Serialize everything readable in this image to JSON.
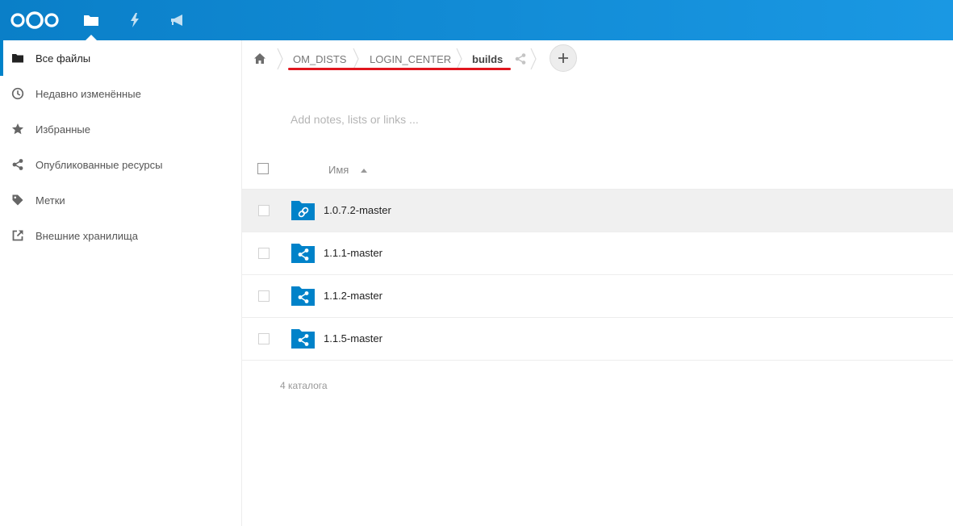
{
  "header": {
    "apps": [
      {
        "icon": "folder-icon",
        "label": "Files"
      },
      {
        "icon": "lightning-icon",
        "label": "Activity"
      },
      {
        "icon": "megaphone-icon",
        "label": "Announcements"
      }
    ]
  },
  "sidebar": {
    "items": [
      {
        "label": "Все файлы",
        "icon": "folder-icon",
        "active": true
      },
      {
        "label": "Недавно изменённые",
        "icon": "clock-icon"
      },
      {
        "label": "Избранные",
        "icon": "star-icon"
      },
      {
        "label": "Опубликованные ресурсы",
        "icon": "share-icon"
      },
      {
        "label": "Метки",
        "icon": "tag-icon"
      },
      {
        "label": "Внешние хранилища",
        "icon": "external-link-icon"
      }
    ]
  },
  "breadcrumb": {
    "items": [
      {
        "label": "OM_DISTS"
      },
      {
        "label": "LOGIN_CENTER"
      },
      {
        "label": "builds",
        "current": true
      }
    ]
  },
  "notes": {
    "placeholder": "Add notes, lists or links ..."
  },
  "file_list": {
    "column_name": "Имя",
    "rows": [
      {
        "name": "1.0.7.2-master",
        "icon": "link-folder-icon"
      },
      {
        "name": "1.1.1-master",
        "icon": "shared-folder-icon"
      },
      {
        "name": "1.1.2-master",
        "icon": "shared-folder-icon"
      },
      {
        "name": "1.1.5-master",
        "icon": "shared-folder-icon"
      }
    ],
    "summary": "4 каталога"
  },
  "colors": {
    "header_start": "#0a7fc8",
    "header_end": "#1a98e3",
    "accent": "#0082c9",
    "annotation_underline": "#e0161e"
  }
}
